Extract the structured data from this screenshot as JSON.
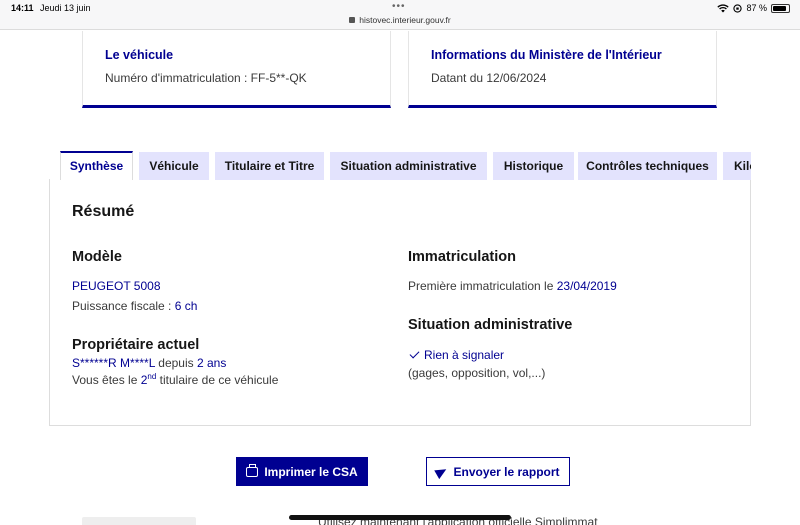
{
  "statusbar": {
    "time": "14:11",
    "date": "Jeudi 13 juin",
    "dots": "•••",
    "url": "histovec.interieur.gouv.fr",
    "battery": "87 %"
  },
  "card_vehicle": {
    "title": "Le véhicule",
    "text": "Numéro d'immatriculation : FF-5**-QK"
  },
  "card_ministry": {
    "title": "Informations du Ministère de l'Intérieur",
    "text": "Datant du 12/06/2024"
  },
  "tabs": [
    {
      "label": "Synthèse",
      "active": true
    },
    {
      "label": "Véhicule",
      "active": false
    },
    {
      "label": "Titulaire et Titre",
      "active": false
    },
    {
      "label": "Situation administrative",
      "active": false
    },
    {
      "label": "Historique",
      "active": false
    },
    {
      "label": "Contrôles techniques",
      "active": false
    },
    {
      "label": "Kilo",
      "active": false
    }
  ],
  "summary": {
    "title": "Résumé",
    "model": {
      "heading": "Modèle",
      "name": "PEUGEOT 5008",
      "power_label": "Puissance fiscale : ",
      "power_value": "6 ch"
    },
    "owner": {
      "heading": "Propriétaire actuel",
      "name": "S******R M****L",
      "since_label": " depuis ",
      "since_value": "2 ans",
      "rank_prefix": "Vous êtes le ",
      "rank_number": "2",
      "rank_suffix": "nd",
      "rank_tail": " titulaire de ce véhicule"
    },
    "registration": {
      "heading": "Immatriculation",
      "label": "Première immatriculation le ",
      "date": "23/04/2019"
    },
    "admin": {
      "heading": "Situation administrative",
      "status": "Rien à signaler",
      "detail": "(gages, opposition, vol,...)"
    }
  },
  "actions": {
    "print_label": "Imprimer le CSA",
    "send_label": "Envoyer le rapport"
  },
  "footer": {
    "text": "Utilisez maintenant l'application officielle Simplimmat"
  }
}
